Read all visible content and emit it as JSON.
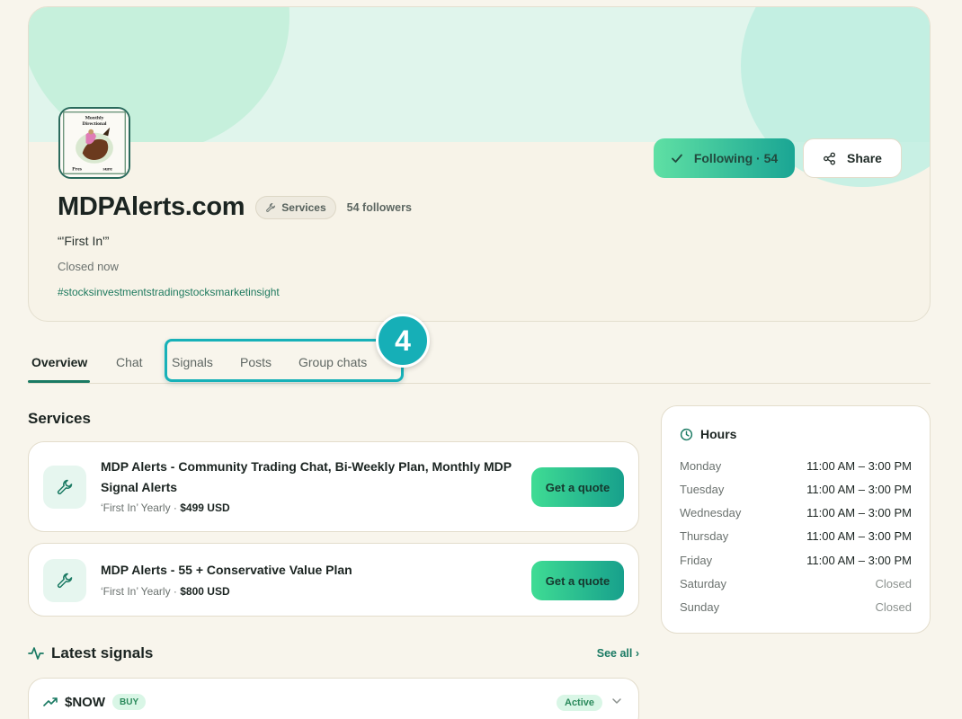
{
  "profile": {
    "name": "MDPAlerts.com",
    "category_chip": "Services",
    "followers": "54 followers",
    "tagline": "“'First In'”",
    "status": "Closed now",
    "hashtag": "#stocksinvestmentstradingstocksmarketinsight",
    "avatar_text_top": "Monthly",
    "avatar_text_mid": "Directional",
    "avatar_text_bottom_left": "Pres",
    "avatar_text_bottom_right": "sure"
  },
  "actions": {
    "following_label": "Following · 54",
    "share_label": "Share"
  },
  "tabs": [
    {
      "label": "Overview",
      "active": true
    },
    {
      "label": "Chat",
      "active": false
    },
    {
      "label": "Signals",
      "active": false
    },
    {
      "label": "Posts",
      "active": false
    },
    {
      "label": "Group chats",
      "active": false
    }
  ],
  "annotation": {
    "step": "4"
  },
  "services": {
    "title": "Services",
    "items": [
      {
        "name": "MDP Alerts - Community Trading Chat, Bi-Weekly Plan, Monthly MDP Signal Alerts",
        "meta": "‘First In’ Yearly · ",
        "price": "$499 USD",
        "cta": "Get a quote"
      },
      {
        "name": "MDP Alerts - 55 + Conservative Value Plan",
        "meta": "‘First In’ Yearly · ",
        "price": "$800 USD",
        "cta": "Get a quote"
      }
    ]
  },
  "hours": {
    "title": "Hours",
    "rows": [
      {
        "day": "Monday",
        "time": "11:00 AM – 3:00 PM",
        "closed": false
      },
      {
        "day": "Tuesday",
        "time": "11:00 AM – 3:00 PM",
        "closed": false
      },
      {
        "day": "Wednesday",
        "time": "11:00 AM – 3:00 PM",
        "closed": false
      },
      {
        "day": "Thursday",
        "time": "11:00 AM – 3:00 PM",
        "closed": false
      },
      {
        "day": "Friday",
        "time": "11:00 AM – 3:00 PM",
        "closed": false
      },
      {
        "day": "Saturday",
        "time": "Closed",
        "closed": true
      },
      {
        "day": "Sunday",
        "time": "Closed",
        "closed": true
      }
    ]
  },
  "signals": {
    "title": "Latest signals",
    "see_all": "See all ›",
    "items": [
      {
        "ticker": "$NOW",
        "side": "BUY",
        "state": "Active"
      }
    ]
  },
  "colors": {
    "accent": "#1a7a63",
    "annotation": "#16afb7",
    "page_bg": "#f8f5ec"
  }
}
